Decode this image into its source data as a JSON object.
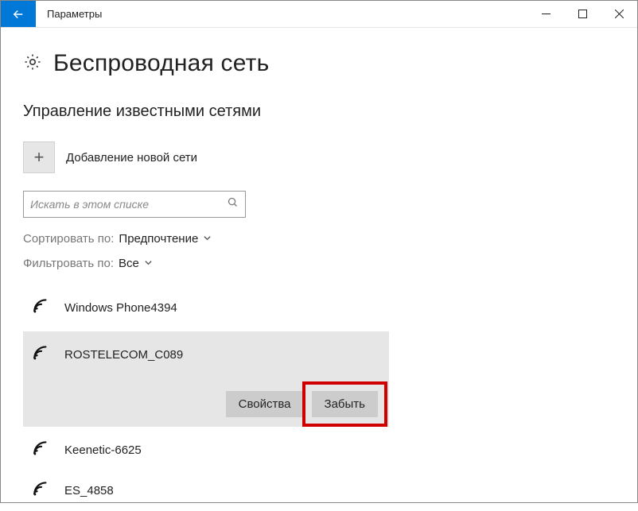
{
  "titlebar": {
    "title": "Параметры"
  },
  "page": {
    "heading": "Беспроводная сеть",
    "section_title": "Управление известными сетями",
    "add_label": "Добавление новой сети"
  },
  "search": {
    "placeholder": "Искать в этом списке"
  },
  "sort": {
    "label": "Сортировать по:",
    "value": "Предпочтение"
  },
  "filter": {
    "label": "Фильтровать по:",
    "value": "Все"
  },
  "networks": [
    {
      "name": "Windows Phone4394"
    },
    {
      "name": "ROSTELECOM_C089"
    },
    {
      "name": "Keenetic-6625"
    },
    {
      "name": "ES_4858"
    }
  ],
  "buttons": {
    "properties": "Свойства",
    "forget": "Забыть"
  }
}
